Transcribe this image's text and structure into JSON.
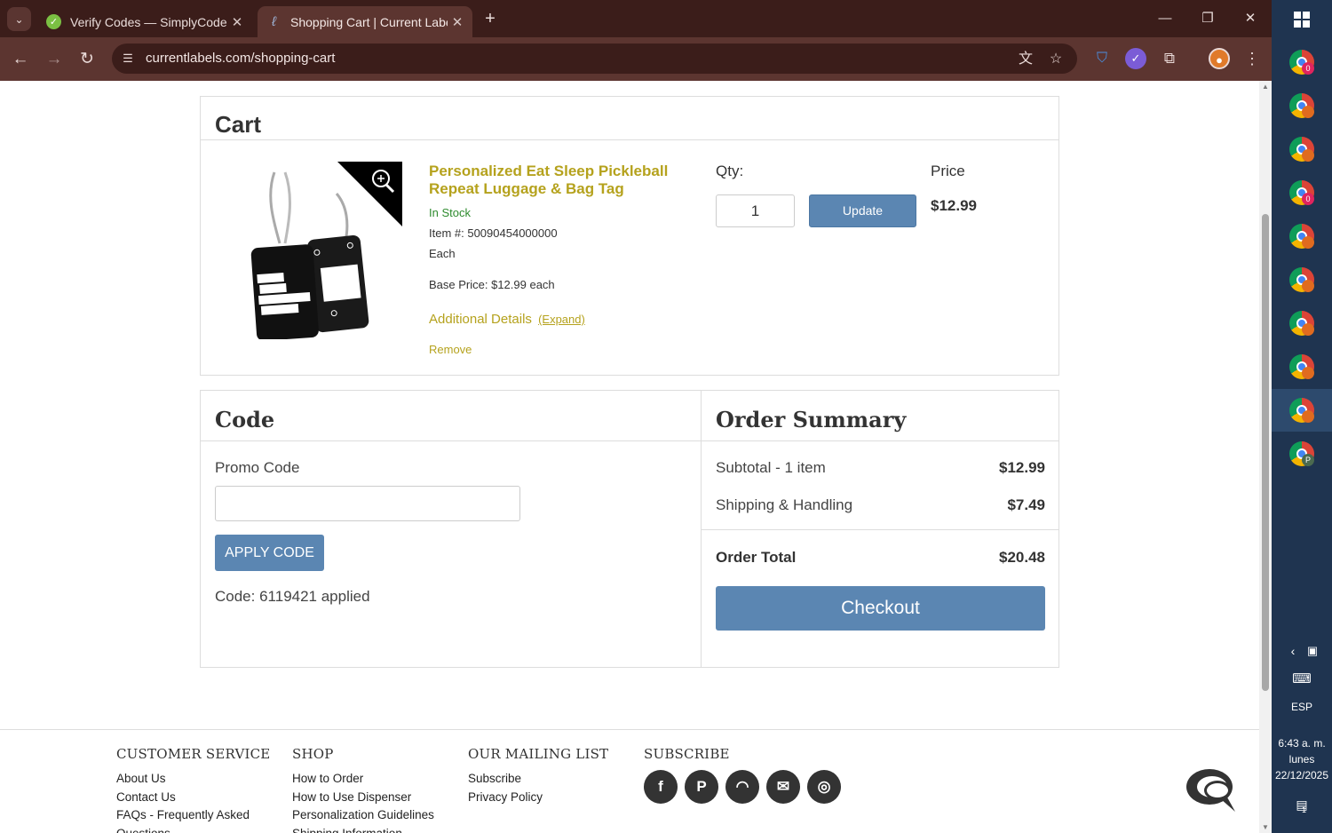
{
  "browser": {
    "tabs": [
      {
        "title": "Verify Codes — SimplyCodes",
        "active": false
      },
      {
        "title": "Shopping Cart | Current Labels",
        "active": true
      }
    ],
    "url": "currentlabels.com/shopping-cart"
  },
  "cart": {
    "heading": "Cart",
    "item": {
      "image_text": "EAT SLEEP PICKLEBALL REPEAT",
      "title": "Personalized Eat Sleep Pickleball Repeat Luggage & Bag Tag",
      "stock": "In Stock",
      "item_number": "Item #: 50090454000000",
      "unit": "Each",
      "base_price": "Base Price: $12.99 each",
      "additional_details": "Additional Details",
      "expand": "(Expand)",
      "remove": "Remove",
      "qty_label": "Qty:",
      "qty_value": "1",
      "update_label": "Update",
      "price_label": "Price",
      "price": "$12.99"
    }
  },
  "code": {
    "heading": "Code",
    "promo_label": "Promo Code",
    "promo_value": "",
    "apply_label": "APPLY CODE",
    "applied_message": "Code: 6119421 applied"
  },
  "summary": {
    "heading": "Order Summary",
    "subtotal_label": "Subtotal - 1 item",
    "subtotal_value": "$12.99",
    "shipping_label": "Shipping & Handling",
    "shipping_value": "$7.49",
    "total_label": "Order Total",
    "total_value": "$20.48",
    "checkout_label": "Checkout"
  },
  "footer": {
    "customer_service": {
      "heading": "CUSTOMER SERVICE",
      "links": [
        "About Us",
        "Contact Us",
        "FAQs - Frequently Asked",
        "Questions"
      ]
    },
    "shop": {
      "heading": "SHOP",
      "links": [
        "How to Order",
        "How to Use Dispenser",
        "Personalization Guidelines",
        "Shipping Information"
      ]
    },
    "mailing": {
      "heading": "OUR MAILING LIST",
      "links": [
        "Subscribe",
        "Privacy Policy"
      ]
    },
    "subscribe": {
      "heading": "SUBSCRIBE",
      "icons": [
        "facebook-icon",
        "pinterest-icon",
        "rss-icon",
        "email-icon",
        "instagram-icon"
      ]
    }
  },
  "taskbar": {
    "apps": [
      {
        "badge": "0",
        "badge_color": "#e0245e"
      },
      {
        "badge": "",
        "badge_color": "#e06b1f"
      },
      {
        "badge": "",
        "badge_color": "#e06b1f"
      },
      {
        "badge": "0",
        "badge_color": "#e0245e"
      },
      {
        "badge": "",
        "badge_color": "#e06b1f"
      },
      {
        "badge": "",
        "badge_color": "#e06b1f"
      },
      {
        "badge": "",
        "badge_color": "#e06b1f"
      },
      {
        "badge": "",
        "badge_color": "#e06b1f"
      },
      {
        "badge": "",
        "badge_color": "#e06b1f"
      },
      {
        "badge": "P",
        "badge_color": "#4b6a4f"
      }
    ],
    "language": "ESP",
    "time": "6:43 a. m.",
    "day": "lunes",
    "date": "22/12/2025",
    "notifications": "1"
  },
  "colors": {
    "accent_gold": "#b5a21d",
    "button_blue": "#5b86b2",
    "in_stock_green": "#2e8b2e"
  }
}
